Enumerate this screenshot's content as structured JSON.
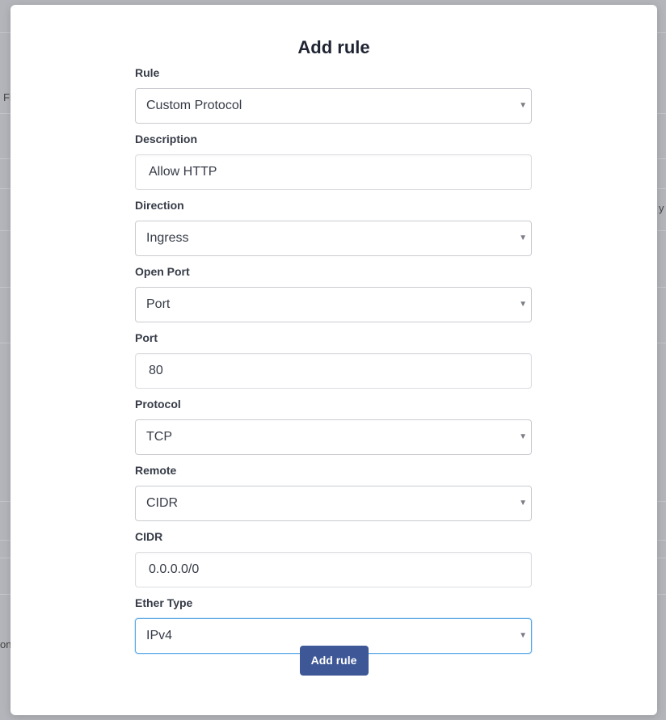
{
  "modal": {
    "title": "Add rule",
    "submit_label": "Add rule"
  },
  "fields": [
    {
      "label": "Rule",
      "value": "Custom Protocol",
      "kind": "select"
    },
    {
      "label": "Description",
      "value": "Allow HTTP",
      "kind": "input"
    },
    {
      "label": "Direction",
      "value": "Ingress",
      "kind": "select"
    },
    {
      "label": "Open Port",
      "value": "Port",
      "kind": "select"
    },
    {
      "label": "Port",
      "value": "80",
      "kind": "input"
    },
    {
      "label": "Protocol",
      "value": "TCP",
      "kind": "select"
    },
    {
      "label": "Remote",
      "value": "CIDR",
      "kind": "select"
    },
    {
      "label": "CIDR",
      "value": "0.0.0.0/0",
      "kind": "input"
    },
    {
      "label": "Ether Type",
      "value": "IPv4",
      "kind": "select"
    }
  ],
  "background": {
    "left_fragment_1": "Fl",
    "left_fragment_2": "on",
    "right_fragment": "y"
  },
  "icons": {
    "select_caret": "▼"
  },
  "colors": {
    "primary_button": "#3d5797",
    "focus_border": "#5aa8e6",
    "overlay": "#b3b5ba"
  }
}
